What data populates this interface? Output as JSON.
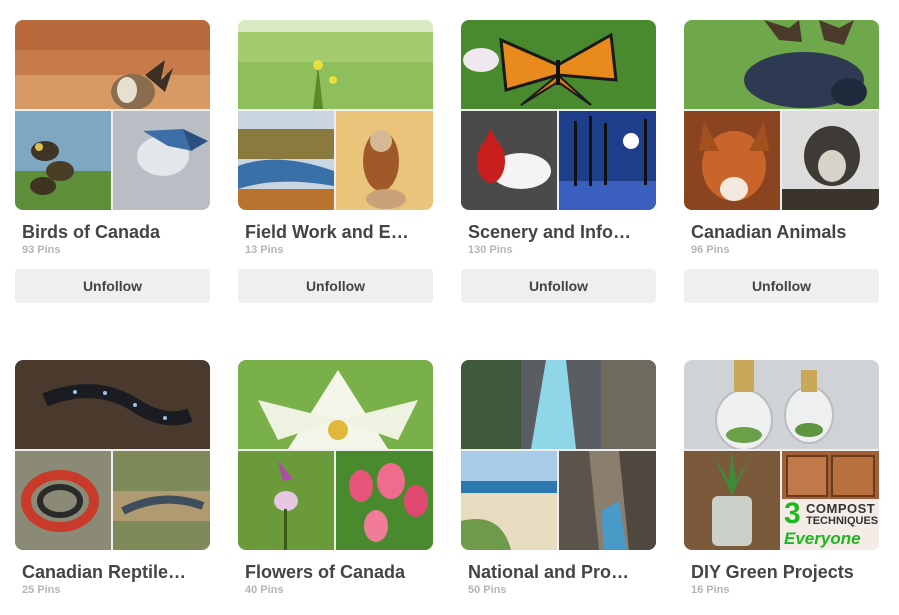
{
  "boards": [
    {
      "title": "Birds of Canada",
      "pins": "93 Pins",
      "button": "Unfollow"
    },
    {
      "title": "Field Work and E…",
      "pins": "13 Pins",
      "button": "Unfollow"
    },
    {
      "title": "Scenery and Info…",
      "pins": "130 Pins",
      "button": "Unfollow"
    },
    {
      "title": "Canadian Animals",
      "pins": "96 Pins",
      "button": "Unfollow"
    },
    {
      "title": "Canadian Reptile…",
      "pins": "25 Pins"
    },
    {
      "title": "Flowers of Canada",
      "pins": "40 Pins"
    },
    {
      "title": "National and Pro…",
      "pins": "50 Pins"
    },
    {
      "title": "DIY Green Projects",
      "pins": "16 Pins"
    }
  ],
  "compost_overlay": {
    "line1": "3",
    "line2": "COMPOST",
    "line3": "TECHNIQUES",
    "line4": "Everyone"
  },
  "colors": {
    "accent_green": "#1db81d",
    "text": "#444444",
    "muted": "#b5b5b5",
    "button_bg": "#efefef"
  }
}
